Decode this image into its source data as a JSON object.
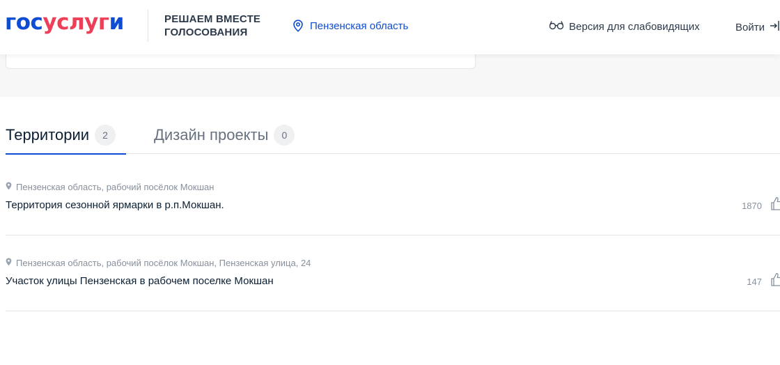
{
  "header": {
    "logo_part1": "гос",
    "logo_part2": "услуг",
    "logo_part3": "и",
    "tagline_line1": "РЕШАЕМ ВМЕСТЕ",
    "tagline_line2": "ГОЛОСОВАНИЯ",
    "region": "Пензенская область",
    "accessibility": "Версия для слабовидящих",
    "login": "Войти"
  },
  "tabs": [
    {
      "label": "Территории",
      "count": "2",
      "active": true
    },
    {
      "label": "Дизайн проекты",
      "count": "0",
      "active": false
    }
  ],
  "items": [
    {
      "address": "Пензенская область, рабочий посёлок Мокшан",
      "title": "Территория сезонной ярмарки в р.п.Мокшан.",
      "votes": "1870"
    },
    {
      "address": "Пензенская область, рабочий посёлок Мокшан, Пензенская улица, 24",
      "title": "Участок улицы Пензенская в рабочем поселке Мокшан",
      "votes": "147"
    }
  ],
  "colors": {
    "brand_blue": "#0d4cd3",
    "brand_red": "#ee3f58",
    "muted_text": "#86909c"
  },
  "icons": {
    "region": "location-pin-icon",
    "accessibility": "glasses-icon",
    "login": "login-arrow-icon",
    "address": "map-marker-icon",
    "like": "thumbs-up-icon"
  }
}
